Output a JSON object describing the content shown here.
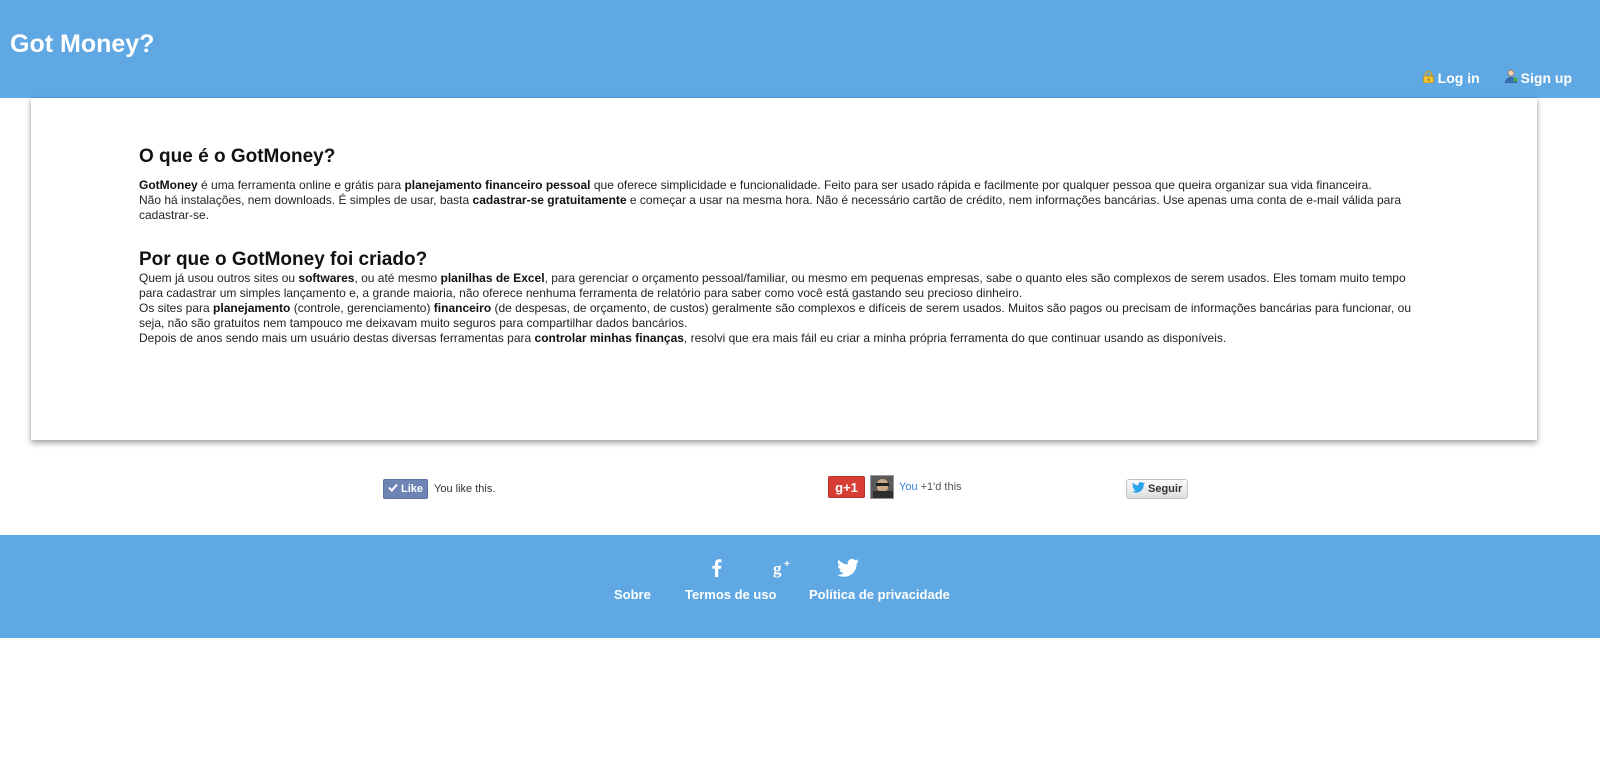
{
  "header": {
    "brand": "Got Money?",
    "login_label": "Log in",
    "signup_label": "Sign up"
  },
  "main": {
    "section1": {
      "title": "O que é o GotMoney?",
      "p1": [
        {
          "t": "GotMoney",
          "b": true
        },
        {
          "t": " é uma ferramenta online e grátis para ",
          "b": false
        },
        {
          "t": "planejamento financeiro pessoal",
          "b": true
        },
        {
          "t": " que oferece simplicidade e funcionalidade. Feito para ser usado rápida e facilmente por qualquer pessoa que queira organizar sua vida financeira.",
          "b": false
        }
      ],
      "p2": [
        {
          "t": "Não há instalações, nem downloads. É simples de usar, basta ",
          "b": false
        },
        {
          "t": "cadastrar-se gratuitamente",
          "b": true
        },
        {
          "t": " e começar a usar na mesma hora. Não é necessário cartão de crédito, nem informações bancárias. Use apenas uma conta de e-mail válida para cadastrar-se.",
          "b": false
        }
      ]
    },
    "section2": {
      "title": "Por que o GotMoney foi criado?",
      "p1": [
        {
          "t": "Quem já usou outros sites ou ",
          "b": false
        },
        {
          "t": "softwares",
          "b": true
        },
        {
          "t": ", ou até mesmo ",
          "b": false
        },
        {
          "t": "planilhas de Excel",
          "b": true
        },
        {
          "t": ", para gerenciar o orçamento pessoal/familiar, ou mesmo em pequenas empresas, sabe o quanto eles são complexos de serem usados. Eles tomam muito tempo para cadastrar um simples lançamento e, a grande maioria, não oferece nenhuma ferramenta de relatório para saber como você está gastando seu precioso dinheiro.",
          "b": false
        }
      ],
      "p2": [
        {
          "t": "Os sites para ",
          "b": false
        },
        {
          "t": "planejamento",
          "b": true
        },
        {
          "t": " (controle, gerenciamento) ",
          "b": false
        },
        {
          "t": "financeiro",
          "b": true
        },
        {
          "t": " (de despesas, de orçamento, de custos) geralmente são complexos e difíceis de serem usados. Muitos são pagos ou precisam de informações bancárias para funcionar, ou seja, não são gratuitos nem tampouco me deixavam muito seguros para compartilhar dados bancários.",
          "b": false
        }
      ],
      "p3": [
        {
          "t": "Depois de anos sendo mais um usuário destas diversas ferramentas para ",
          "b": false
        },
        {
          "t": "controlar minhas finanças",
          "b": true
        },
        {
          "t": ", resolvi que era mais fáil eu criar a minha própria ferramenta do que continuar usando as disponíveis.",
          "b": false
        }
      ]
    }
  },
  "social": {
    "facebook": {
      "button_label": "Like",
      "status": "You like this."
    },
    "googleplus": {
      "button_label": "+1",
      "you": "You",
      "status": " +1'd this"
    },
    "twitter": {
      "button_label": "Seguir"
    }
  },
  "footer": {
    "icons": [
      "facebook-icon",
      "google-plus-icon",
      "twitter-icon"
    ],
    "links": [
      "Sobre",
      "Termos de uso",
      "Política de privacidade"
    ]
  },
  "colors": {
    "brand_blue": "#5fa8e4",
    "facebook": "#6d84b4",
    "googleplus": "#d73d32"
  }
}
